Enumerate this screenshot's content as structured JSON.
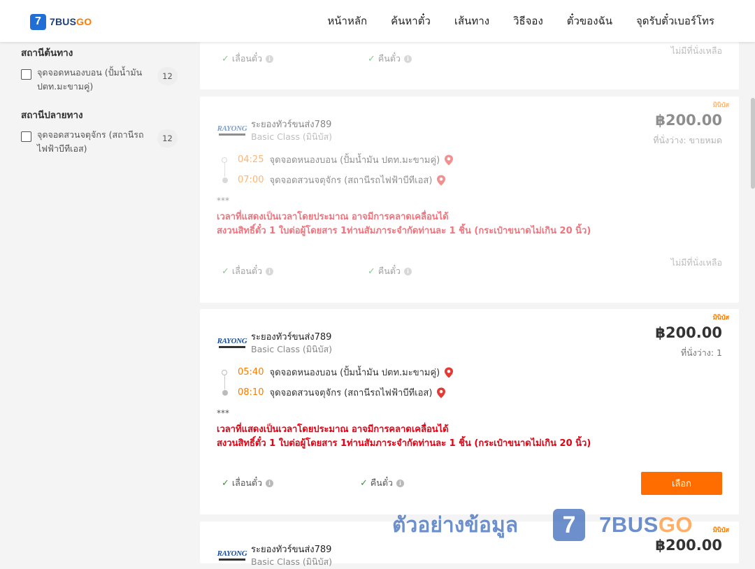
{
  "brand": {
    "mark": "7",
    "name_main": "7BUS",
    "name_accent": "GO"
  },
  "nav": [
    "หน้าหลัก",
    "ค้นหาตั๋ว",
    "เส้นทาง",
    "วิธีจอง",
    "ตั๋วของฉัน",
    "จุดรับตั๋วเบอร์โทร"
  ],
  "filters": {
    "origin": {
      "title": "สถานีต้นทาง",
      "option": "จุดจอดหนองบอน (ปั้มน้ำมัน ปตท.มะขามคู่)",
      "count": "12"
    },
    "destination": {
      "title": "สถานีปลายทาง",
      "option": "จุดจอดสวนจตุจักร (สถานีรถไฟฟ้าบีทีเอส)",
      "count": "12"
    }
  },
  "card0": {
    "reschedule": "เลื่อนตั๋ว",
    "refund": "คืนตั๋ว",
    "availability": "ไม่มีที่นั่งเหลือ"
  },
  "card1": {
    "type": "มินิบัส",
    "logo": "RAYONG",
    "operator": "ระยองทัวร์ขนส่ง789",
    "class": "Basic Class (มินิบัส)",
    "price": "฿200.00",
    "seats": "ที่นั่งว่าง: ขายหมด",
    "dep_time": "04:25",
    "dep_stop": "จุดจอดหนองบอน (ปั้มน้ำมัน ปตท.มะขามคู่)",
    "arr_time": "07:00",
    "arr_stop": "จุดจอดสวนจตุจักร (สถานีรถไฟฟ้าบีทีเอส)",
    "stars": "***",
    "note1": "เวลาที่แสดงเป็นเวลาโดยประมาณ อาจมีการคลาดเคลื่อนได้",
    "note2": "สงวนสิทธิ์ตั๋ว 1 ใบต่อผู้โดยสาร 1ท่านสัมภาระจำกัดท่านละ 1 ชิ้น (กระเป๋าขนาดไม่เกิน 20 นิ้ว)",
    "reschedule": "เลื่อนตั๋ว",
    "refund": "คืนตั๋ว",
    "availability": "ไม่มีที่นั่งเหลือ"
  },
  "card2": {
    "type": "มินิบัส",
    "logo": "RAYONG",
    "operator": "ระยองทัวร์ขนส่ง789",
    "class": "Basic Class (มินิบัส)",
    "price": "฿200.00",
    "seats": "ที่นั่งว่าง: 1",
    "dep_time": "05:40",
    "dep_stop": "จุดจอดหนองบอน (ปั้มน้ำมัน ปตท.มะขามคู่)",
    "arr_time": "08:10",
    "arr_stop": "จุดจอดสวนจตุจักร (สถานีรถไฟฟ้าบีทีเอส)",
    "stars": "***",
    "note1": "เวลาที่แสดงเป็นเวลาโดยประมาณ อาจมีการคลาดเคลื่อนได้",
    "note2": "สงวนสิทธิ์ตั๋ว 1 ใบต่อผู้โดยสาร 1ท่านสัมภาระจำกัดท่านละ 1 ชิ้น (กระเป๋าขนาดไม่เกิน 20 นิ้ว)",
    "reschedule": "เลื่อนตั๋ว",
    "refund": "คืนตั๋ว",
    "select": "เลือก"
  },
  "card3": {
    "type": "มินิบัส",
    "logo": "RAYONG",
    "operator": "ระยองทัวร์ขนส่ง789",
    "class": "Basic Class (มินิบัส)",
    "price": "฿200.00"
  },
  "watermark": {
    "text": "ตัวอย่างข้อมูล",
    "mark": "7",
    "name_main": "7BUS",
    "name_accent": "GO"
  },
  "colors": {
    "accent": "#ff6d00",
    "brand": "#1f6fd6",
    "note": "#e60012",
    "check": "#2e9a3a",
    "pin": "#e53935"
  }
}
